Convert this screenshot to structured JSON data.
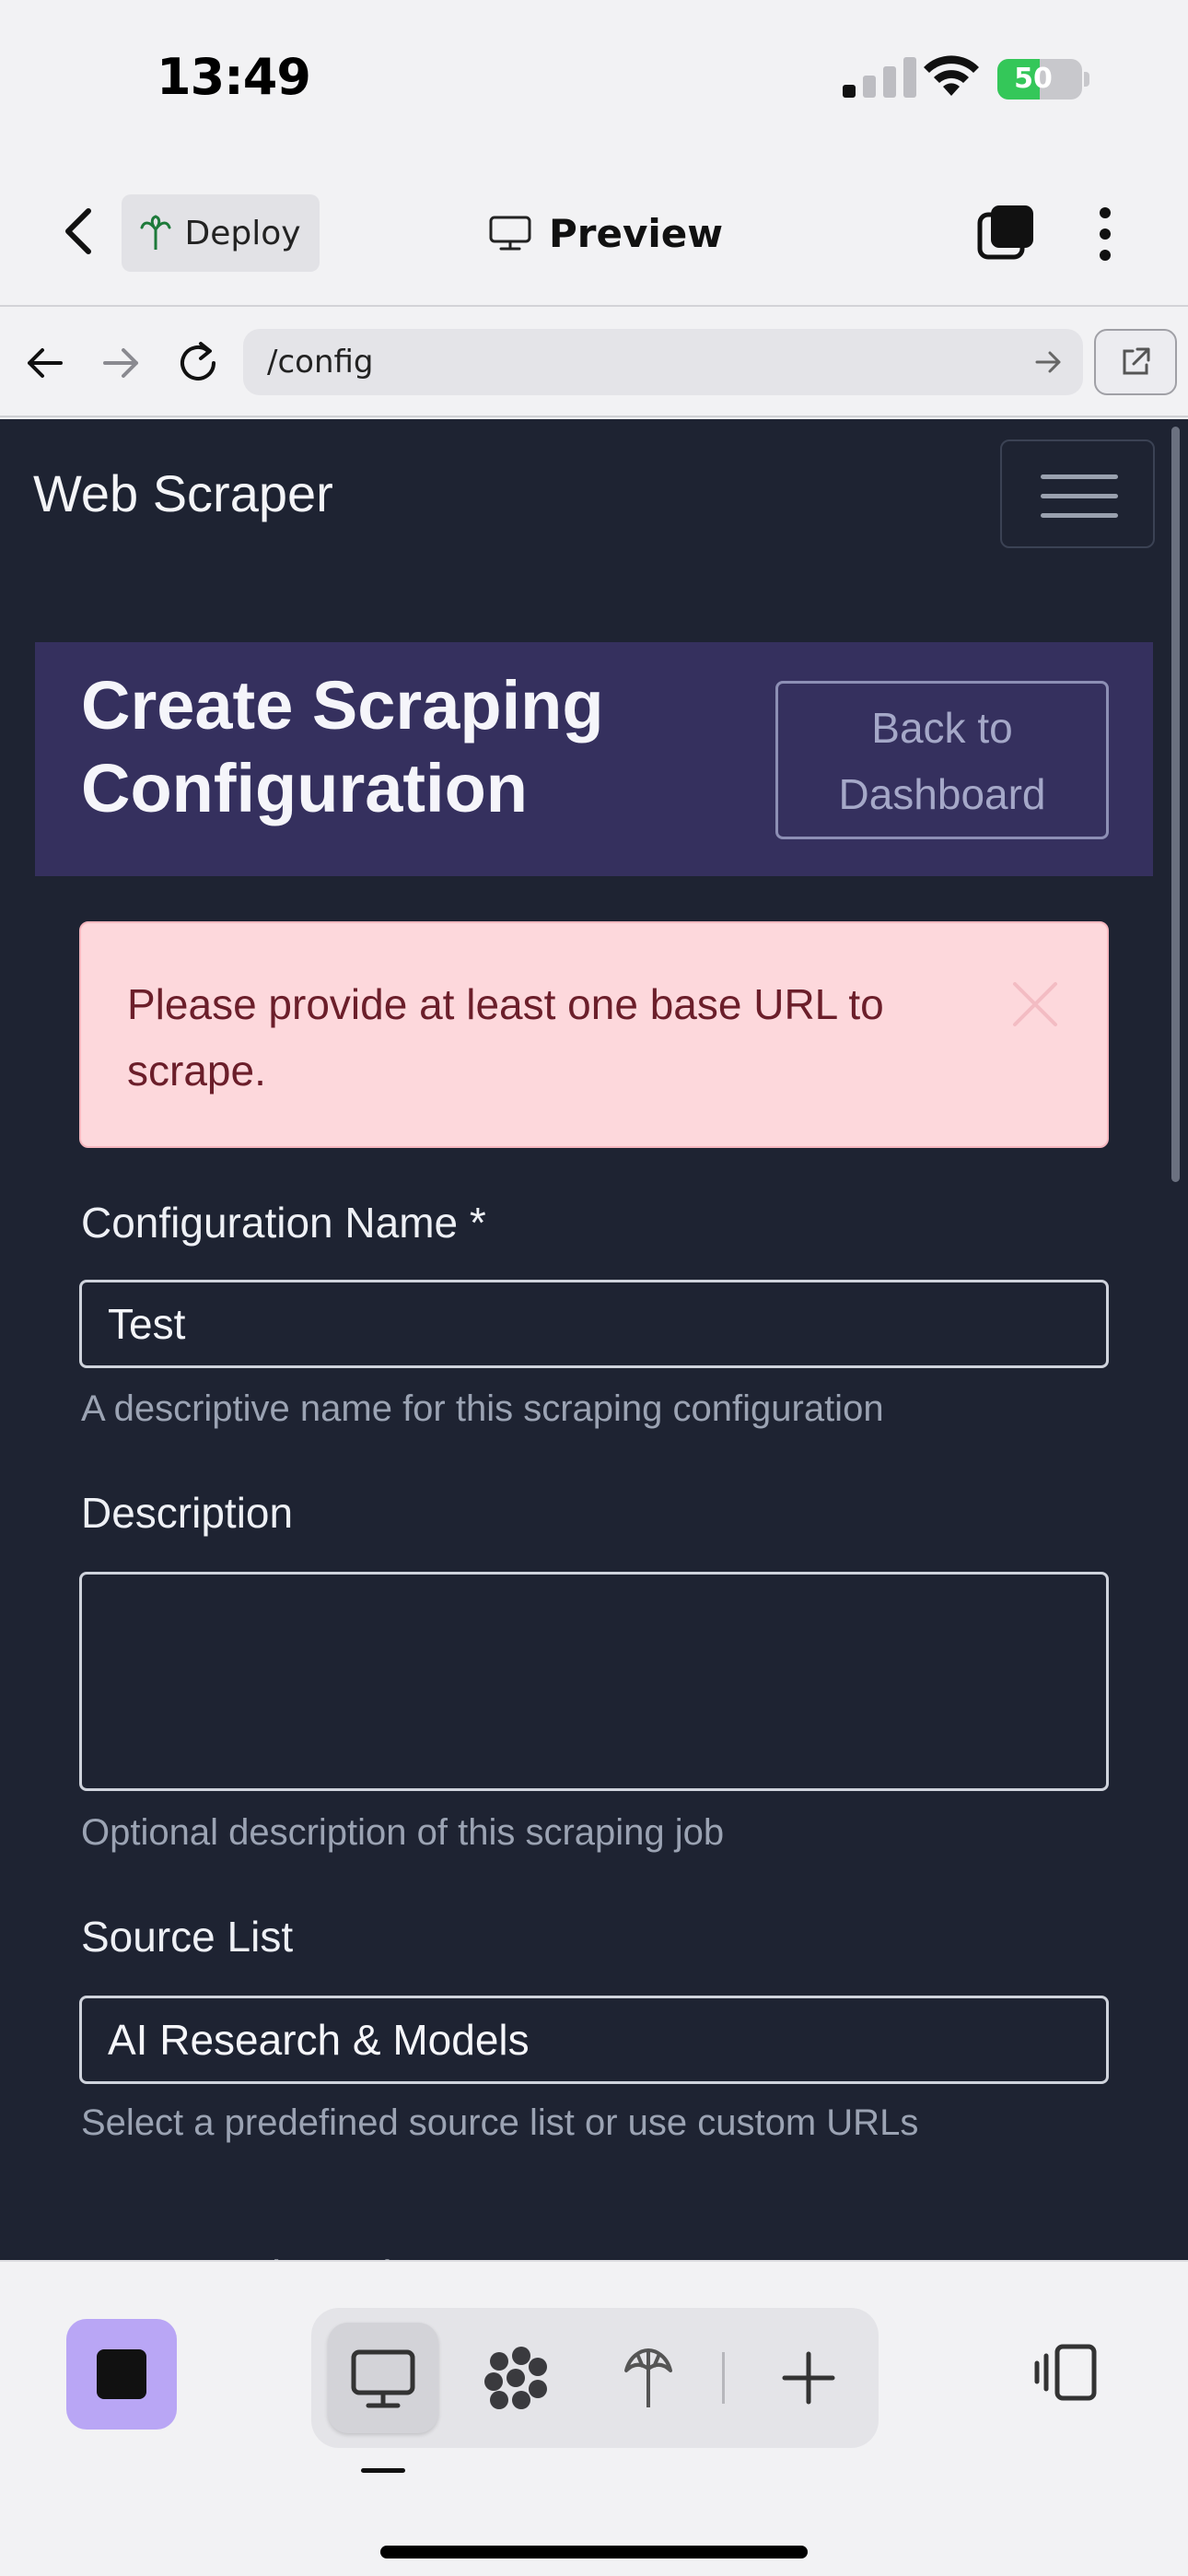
{
  "status_bar": {
    "time": "13:49",
    "battery": "50",
    "battery_level": 0.5
  },
  "app_header": {
    "deploy_label": "Deploy",
    "preview_label": "Preview"
  },
  "browser": {
    "url": "/config"
  },
  "web": {
    "brand": "Web Scraper",
    "card": {
      "title": "Create Scraping Configuration",
      "back_button": "Back to Dashboard"
    },
    "alert": {
      "message": "Please provide at least one base URL to scrape."
    },
    "form": {
      "name_label": "Configuration Name *",
      "name_value": "Test",
      "name_hint": "A descriptive name for this scraping configuration",
      "description_label": "Description",
      "description_value": "",
      "description_hint": "Optional description of this scraping job",
      "source_label": "Source List",
      "source_value": "AI Research & Models",
      "source_hint": "Select a predefined source list or use custom URLs",
      "next_label_partial": "Max Crawl Depth"
    }
  },
  "icons": {
    "back": "chevron-left-icon",
    "deploy": "palm-tree-icon",
    "preview": "monitor-icon",
    "tabs": "tabs-icon",
    "more": "more-vertical-icon",
    "nav_back": "arrow-left-icon",
    "nav_forward": "arrow-right-icon",
    "reload": "reload-icon",
    "url_go": "arrow-right-icon",
    "open_external": "external-link-icon",
    "close": "close-icon",
    "monitor": "monitor-icon",
    "grid": "grid-icon",
    "deploy_tab": "palm-tree-icon",
    "add": "plus-icon",
    "device": "device-toggle-icon"
  },
  "colors": {
    "page_bg": "#1e2332",
    "card_header_bg": "#35305e",
    "alert_bg": "#fdd8dc",
    "alert_text": "#6b1e2a",
    "stop_button": "#b9a6f5"
  }
}
